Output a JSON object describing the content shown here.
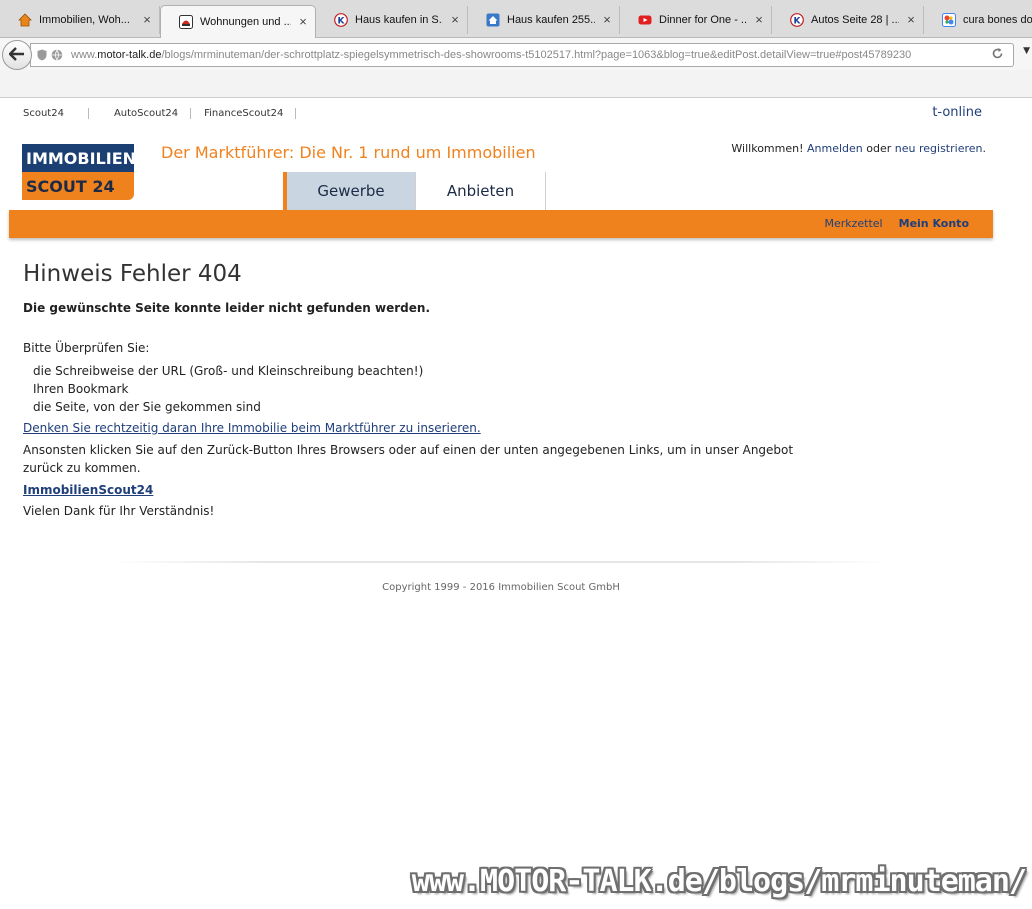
{
  "browser": {
    "tabs": [
      {
        "title": "Immobilien, Woh...",
        "icon": "house-icon",
        "icon_color": "#e8861a"
      },
      {
        "title": "Wohnungen und ...",
        "icon": "immoscout-icon",
        "icon_color": "#cc2a1e"
      },
      {
        "title": "Haus kaufen in S...",
        "icon": "k-logo-icon",
        "icon_color": "#c41f1f"
      },
      {
        "title": "Haus kaufen 255...",
        "icon": "blue-house-icon",
        "icon_color": "#3a78c9"
      },
      {
        "title": "Dinner for One - ...",
        "icon": "youtube-icon",
        "icon_color": "#e02020"
      },
      {
        "title": "Autos Seite 28 | ...",
        "icon": "k-logo-icon",
        "icon_color": "#c41f1f"
      },
      {
        "title": "cura bones dog r",
        "icon": "google-icon",
        "icon_color": "#4285f4"
      }
    ],
    "url_prefix": "www.",
    "url_domain": "motor-talk.de",
    "url_path": "/blogs/mrminuteman/der-schrottplatz-spiegelsymmetrisch-des-showrooms-t5102517.html?page=1063&blog=true&editPost.detailView=true#post45789230"
  },
  "header": {
    "toplinks": [
      "Scout24",
      "AutoScout24",
      "FinanceScout24"
    ],
    "tonline": "t-online",
    "logo_top": "IMMOBILIEN",
    "logo_bottom": "SCOUT 24",
    "tagline": "Der Marktführer: Die Nr. 1 rund um Immobilien",
    "welcome_prefix": "Willkommen! ",
    "login": "Anmelden",
    "welcome_or": " oder ",
    "register": "neu registrieren",
    "welcome_suffix": ".",
    "tabs": [
      "Gewerbe",
      "Anbieten"
    ],
    "merkzettel": "Merkzettel",
    "mein_konto": "Mein Konto"
  },
  "content": {
    "title": "Hinweis Fehler 404",
    "subtitle": "Die gewünschte Seite konnte leider nicht gefunden werden.",
    "check_intro": "Bitte Überprüfen Sie:",
    "check_items": [
      "die Schreibweise der URL (Groß- und Kleinschreibung beachten!)",
      "Ihren Bookmark",
      "die Seite, von der Sie gekommen sind"
    ],
    "promo_link": "Denken Sie rechtzeitig daran Ihre Immobilie beim Marktführer zu inserieren.",
    "paragraph": "Ansonsten klicken Sie auf den Zurück-Button Ihres Browsers oder auf einen der unten angegebenen Links, um in unser Angebot zurück zu kommen.",
    "brand_link": "ImmobilienScout24",
    "thanks": "Vielen Dank für Ihr Verständnis!"
  },
  "footer": {
    "copyright": "Copyright 1999 - 2016 Immobilien Scout GmbH"
  },
  "watermark": "www.MOTOR-TALK.de/blogs/mrminuteman/"
}
